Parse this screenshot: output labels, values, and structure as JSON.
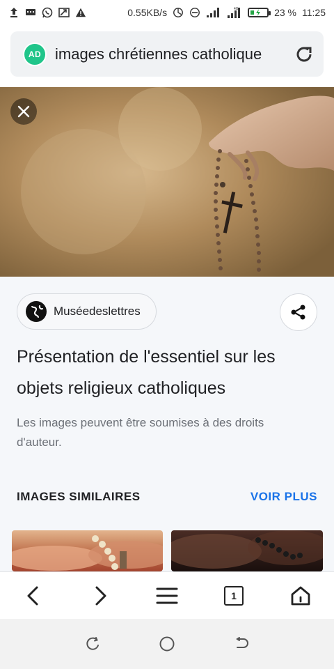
{
  "status_bar": {
    "speed": "0.55KB/s",
    "battery_percent_label": "23 %",
    "battery_level": 0.23,
    "time": "11:25",
    "icons": [
      "upload-icon",
      "message-icon",
      "whatsapp-icon",
      "screen-cast-icon",
      "warning-icon",
      "data-saver-icon",
      "do-not-disturb-icon",
      "signal-icon",
      "signal-4g-icon",
      "battery-icon"
    ]
  },
  "url_bar": {
    "badge_text": "AD",
    "text": "images chrétiennes catholique",
    "badge_color": "#20c58a"
  },
  "detail": {
    "source": "Muséedeslettres",
    "title": "Présentation de l'essentiel sur les objets religieux catholiques",
    "copyright": "Les images peuvent être soumises à des droits d'auteur.",
    "similar_title": "IMAGES SIMILAIRES",
    "see_more": "VOIR PLUS",
    "accent_color": "#1a73e8"
  },
  "browser_nav": {
    "tab_count": "1",
    "icons": [
      "back-icon",
      "forward-icon",
      "menu-icon",
      "tabs-icon",
      "home-icon"
    ]
  },
  "system_nav": {
    "icons": [
      "recent-apps-icon",
      "home-circle-icon",
      "back-system-icon"
    ]
  }
}
